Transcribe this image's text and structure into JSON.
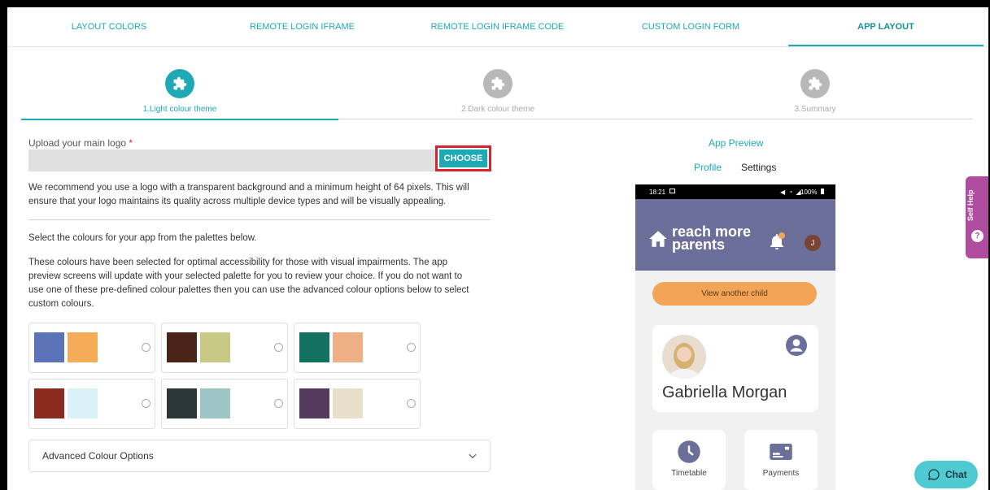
{
  "tabs": [
    "LAYOUT COLORS",
    "REMOTE LOGIN IFRAME",
    "REMOTE LOGIN IFRAME CODE",
    "CUSTOM LOGIN FORM",
    "APP LAYOUT"
  ],
  "steps": [
    "1.Light colour theme",
    "2.Dark colour theme",
    "3.Summary"
  ],
  "upload": {
    "label": "Upload your main logo",
    "required_mark": "*",
    "choose_label": "CHOOSE"
  },
  "texts": {
    "logo_hint_1": "We recommend you use a logo with a transparent background and a minimum height of 64 pixels. This will",
    "logo_hint_2": "ensure that your logo maintains its quality across multiple device types and will be visually appealing.",
    "select_palettes": "Select the colours for your app from the palettes below.",
    "access_1": "These colours have been selected for optimal accessibility for those with visual impairments. The app",
    "access_2": "preview screens will update with your selected palette for you to review your choice. If you do not want to",
    "access_3": "use one of these pre-defined colour palettes then you can use the advanced colour options below to select",
    "access_4": "custom colours."
  },
  "palettes": [
    {
      "primary": "#5b74b7",
      "secondary": "#f5ac58"
    },
    {
      "primary": "#4c2417",
      "secondary": "#c9c986"
    },
    {
      "primary": "#13715f",
      "secondary": "#edaf83"
    },
    {
      "primary": "#8b2a1f",
      "secondary": "#d9f2f7"
    },
    {
      "primary": "#293837",
      "secondary": "#9ec5c6"
    },
    {
      "primary": "#563a5b",
      "secondary": "#e8dfc8"
    }
  ],
  "advanced": {
    "label": "Advanced Colour Options"
  },
  "preview": {
    "title": "App Preview",
    "tab_profile": "Profile",
    "tab_settings": "Settings",
    "status_time": "18:21",
    "status_battery": "100%",
    "logo_line1": "reach more",
    "logo_line2": "parents",
    "avatar_initial": "J",
    "view_another": "View another child",
    "child_name": "Gabriella Morgan",
    "tile_timetable": "Timetable",
    "tile_payments": "Payments"
  },
  "selfhelp_label": "Self Help",
  "chat_label": "Chat",
  "colors": {
    "accent": "#1fa9b4",
    "header": "#6b6f99",
    "highlight_border": "#d9232d"
  }
}
